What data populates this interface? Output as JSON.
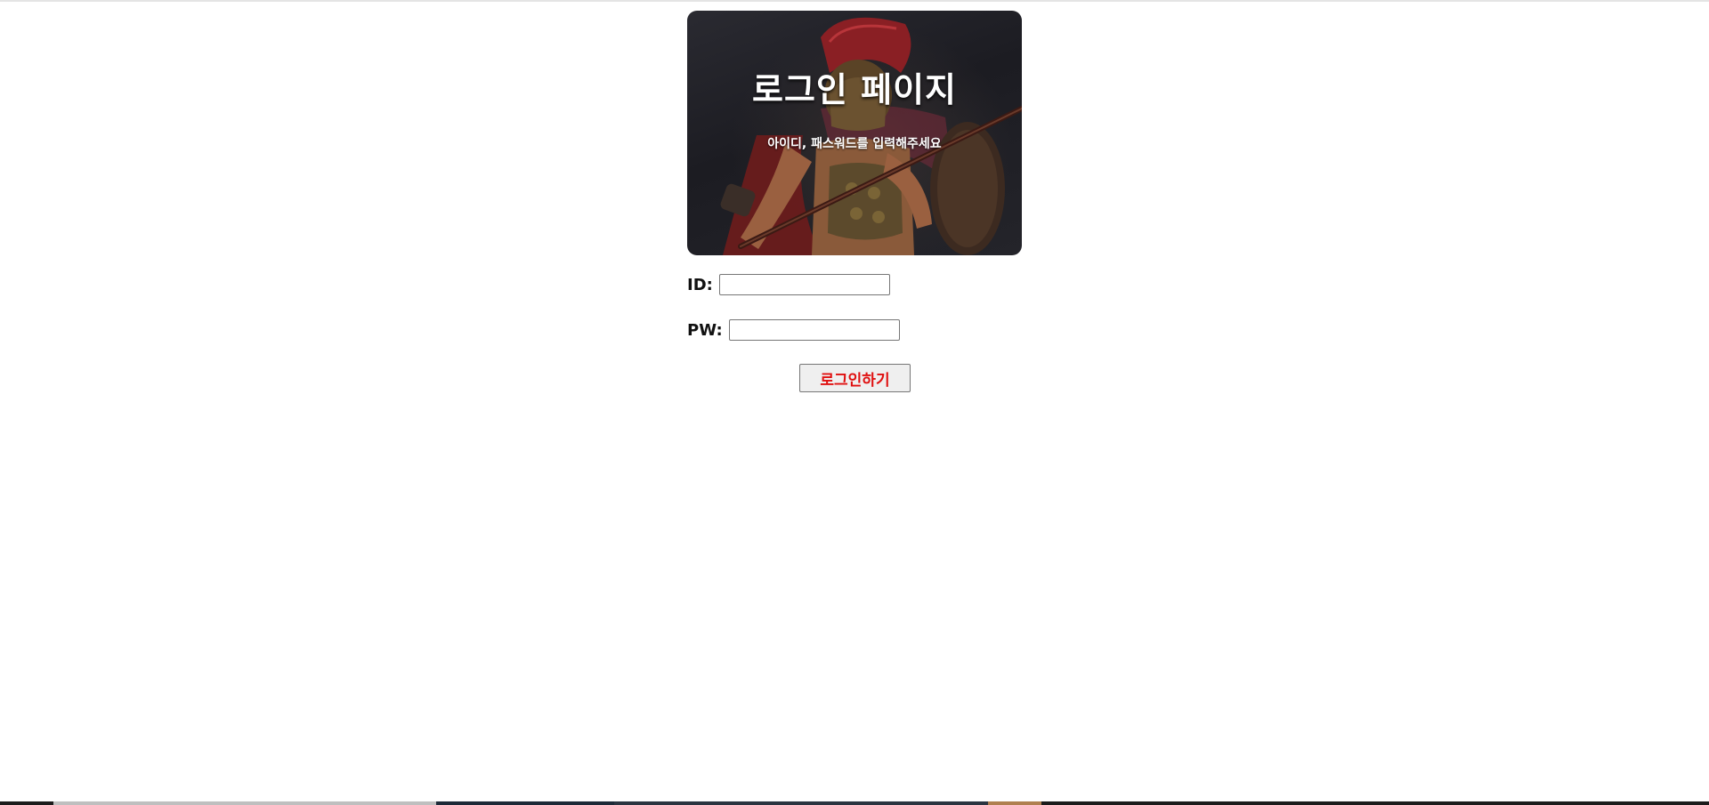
{
  "hero": {
    "title": "로그인 페이지",
    "subtitle": "아이디, 패스워드를 입력해주세요",
    "image_subject": "spartan-warrior-illustration"
  },
  "form": {
    "id_label": "ID:",
    "id_value": "",
    "pw_label": "PW:",
    "pw_value": "",
    "submit_label": "로그인하기"
  },
  "colors": {
    "submit_text": "#e01010",
    "hero_background": "#1f1f25",
    "title_text": "#ffffff"
  }
}
